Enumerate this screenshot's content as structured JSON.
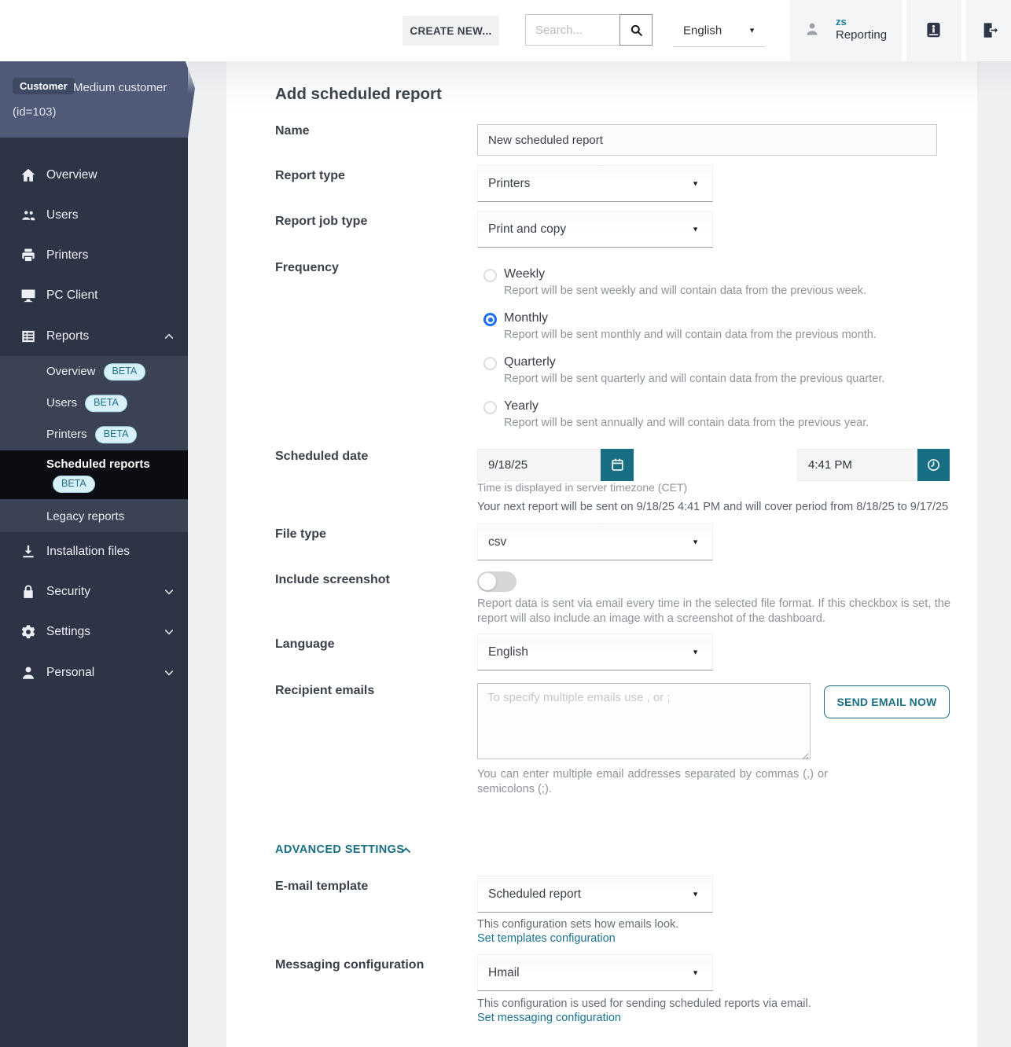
{
  "colors": {
    "accent": "#186f83",
    "blue": "#1b6ff2",
    "sidebar": "#2d3446",
    "submenu": "#3a4254",
    "active": "#0b0d12",
    "banner": "#4f5a78",
    "beta-bg": "#d8f1f8",
    "beta-text": "#23708a"
  },
  "header": {
    "create_new_label": "CREATE NEW...",
    "search_placeholder": "Search...",
    "language": "English",
    "user_initials": "zs",
    "user_name": "Reporting"
  },
  "customer_banner": {
    "badge": "Customer",
    "name": "Medium customer",
    "id_line": "(id=103)"
  },
  "sidebar": {
    "main": [
      {
        "label": "Overview"
      },
      {
        "label": "Users"
      },
      {
        "label": "Printers"
      },
      {
        "label": "PC Client"
      },
      {
        "label": "Reports"
      }
    ],
    "sub": [
      {
        "label": "Overview",
        "beta": "BETA"
      },
      {
        "label": "Users",
        "beta": "BETA"
      },
      {
        "label": "Printers",
        "beta": "BETA"
      },
      {
        "label": "Scheduled reports",
        "beta": "BETA"
      },
      {
        "label": "Legacy reports"
      }
    ],
    "bottom": [
      {
        "label": "Installation files"
      },
      {
        "label": "Security"
      },
      {
        "label": "Settings"
      },
      {
        "label": "Personal"
      }
    ]
  },
  "form": {
    "title": "Add scheduled report",
    "name": {
      "label": "Name",
      "value": "New scheduled report"
    },
    "report_type": {
      "label": "Report type",
      "value": "Printers"
    },
    "report_job_type": {
      "label": "Report job type",
      "value": "Print and copy"
    },
    "frequency": {
      "label": "Frequency",
      "options": [
        {
          "label": "Weekly",
          "desc": "Report will be sent weekly and will contain data from the previous week.",
          "selected": false
        },
        {
          "label": "Monthly",
          "desc": "Report will be sent monthly and will contain data from the previous month.",
          "selected": true
        },
        {
          "label": "Quarterly",
          "desc": "Report will be sent quarterly and will contain data from the previous quarter.",
          "selected": false
        },
        {
          "label": "Yearly",
          "desc": "Report will be sent annually and will contain data from the previous year.",
          "selected": false
        }
      ]
    },
    "scheduled_date": {
      "label": "Scheduled date",
      "date": "9/18/25",
      "time": "4:41 PM",
      "tz_note": "Time is displayed in server timezone (CET)",
      "next_note": "Your next report will be sent on 9/18/25 4:41 PM and will cover period from 8/18/25 to 9/17/25"
    },
    "file_type": {
      "label": "File type",
      "value": "csv"
    },
    "include_screenshot": {
      "label": "Include screenshot",
      "on": false,
      "desc": "Report data is sent via email every time in the selected file format. If this checkbox is set, the report will also include an image with a screenshot of the dashboard."
    },
    "language": {
      "label": "Language",
      "value": "English"
    },
    "recipient_emails": {
      "label": "Recipient emails",
      "placeholder": "To specify multiple emails use , or ;",
      "send_button": "SEND EMAIL NOW",
      "desc": "You can enter multiple email addresses separated by commas (,) or semicolons (;)."
    },
    "advanced": {
      "title": "ADVANCED SETTINGS",
      "email_template": {
        "label": "E-mail template",
        "value": "Scheduled report",
        "desc": "This configuration sets how emails look.",
        "link": "Set templates configuration"
      },
      "messaging": {
        "label": "Messaging configuration",
        "value": "Hmail",
        "desc": "This configuration is used for sending scheduled reports via email.",
        "link": "Set messaging configuration"
      }
    }
  }
}
